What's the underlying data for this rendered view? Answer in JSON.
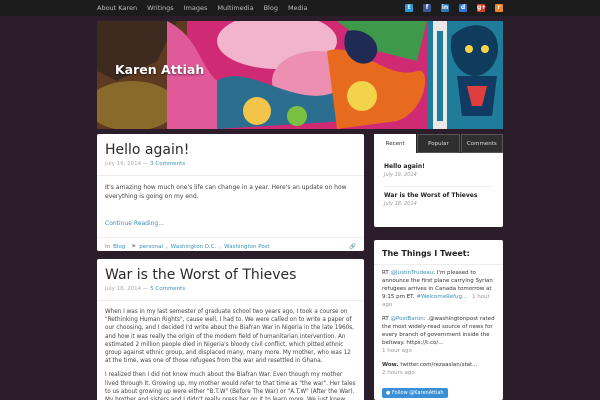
{
  "nav": {
    "items": [
      "About Karen",
      "Writings",
      "Images",
      "Multimedia",
      "Blog",
      "Media"
    ],
    "social": [
      {
        "name": "twitter-icon",
        "glyph": "t",
        "color": "#2d9ad8"
      },
      {
        "name": "facebook-icon",
        "glyph": "f",
        "color": "#3b5998"
      },
      {
        "name": "linkedin-icon",
        "glyph": "in",
        "color": "#2a7ab5"
      },
      {
        "name": "delicious-icon",
        "glyph": "d",
        "color": "#3274d1"
      },
      {
        "name": "google-plus-icon",
        "glyph": "g+",
        "color": "#d0422f"
      },
      {
        "name": "rss-icon",
        "glyph": "r",
        "color": "#f0862c"
      }
    ]
  },
  "site": {
    "title": "Karen Attiah"
  },
  "posts": [
    {
      "title": "Hello again!",
      "date": "July 19, 2014",
      "comments": "3 Comments",
      "excerpt": "It's amazing how much one's life can change in a year. Here's an update on how everything is going on my end.",
      "continue": "Continue Reading...",
      "category_prefix": "In",
      "category": "Blog",
      "tags": [
        "personal",
        "Washington D.C.",
        "Washington Post"
      ]
    },
    {
      "title": "War is the Worst of Thieves",
      "date": "July 18, 2014",
      "comments": "5 Comments",
      "p1": "When I was in my last semester of graduate school two years ago, I took a course on \"Rethinking Human Rights\", cause well, I had to. We were called on to write a paper of our choosing, and I decided I'd write about the Biafran War in Nigeria in the late 1960s, and how it was really the origin of the modern field of humanitarian intervention. An estimated 2 million people died in Nigeria's bloody civil conflict, which pitted ethnic group against ethnic group, and displaced many, many more. My mother, who was 12 at the time, was one of those refugees from the war and resettled in Ghana.",
      "p2": "I realized then I did not know much about the Biafran War. Even though my mother lived through it. Growing up, my mother would refer to that time as \"the war\". Her tales to us about growing up were either \"B.T.W\" (Before The War) or \"A.T.W\" (After the War). My brother and sisters and I didn't really press her on it to learn more. We just knew"
    }
  ],
  "sidebar": {
    "tabs": [
      "Recent",
      "Popular",
      "Comments"
    ],
    "recent": [
      {
        "title": "Hello again!",
        "date": "July 19, 2014"
      },
      {
        "title": "War is the Worst of Thieves",
        "date": "July 18, 2014"
      }
    ],
    "tweets_title": "The Things I Tweet:",
    "tweets": [
      {
        "prefix": "RT ",
        "user": "@JustinTrudeau",
        "text": ": I'm pleased to announce the first plane carrying Syrian refugees arrives in Canada tomorrow at 9:15 pm ET. ",
        "tag": "#WelcomeRefug...",
        "ago": "1 hour ago"
      },
      {
        "prefix": "RT ",
        "user": "@PostBaron",
        "text": ": .@washingtonpost rated the most widely-read source of news for every branch of government inside the beltway. https://t.co/...",
        "tag": "",
        "ago": "1 hour ago"
      },
      {
        "prefix": "Wow. ",
        "user": "",
        "text": "twitter.com/rezaaslan/stat...",
        "tag": "",
        "ago": "2 hours ago"
      }
    ],
    "follow": "Follow @KarenAttiah"
  }
}
